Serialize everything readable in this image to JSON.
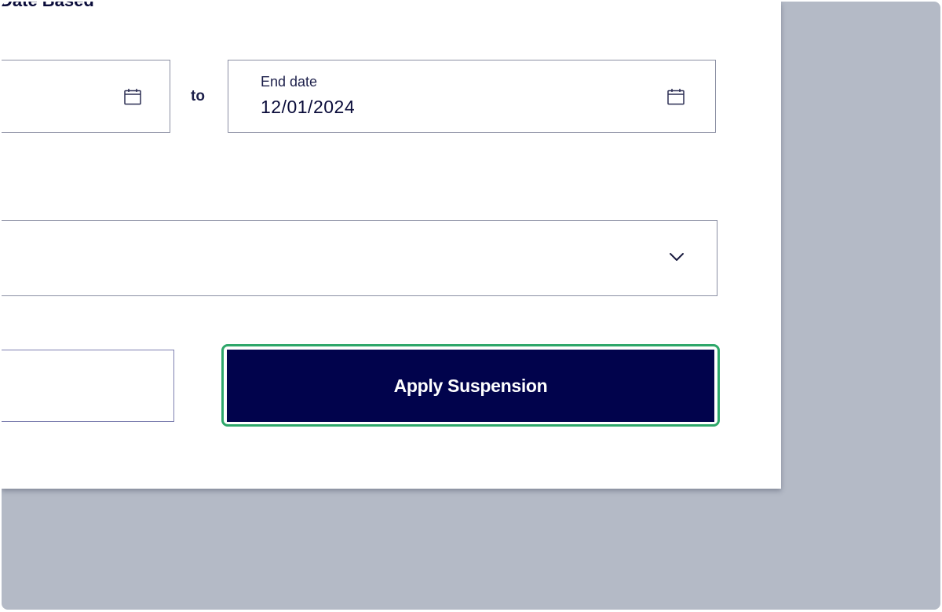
{
  "form": {
    "heading": "Date Based",
    "start_date": {
      "label": "",
      "value": ""
    },
    "range_separator": "to",
    "end_date": {
      "label": "End date",
      "value": "12/01/2024"
    },
    "reason_select": {
      "value": ""
    },
    "secondary_button_label": "",
    "apply_button_label": "Apply Suspension"
  },
  "colors": {
    "backdrop": "#b4bac6",
    "primary_button": "#01034c",
    "highlight_outline": "#2ea76a",
    "text": "#0a0c3a",
    "field_border": "#8b8fa3"
  },
  "icons": {
    "start_date": "calendar-icon",
    "end_date": "calendar-icon",
    "select": "chevron-down-icon"
  }
}
